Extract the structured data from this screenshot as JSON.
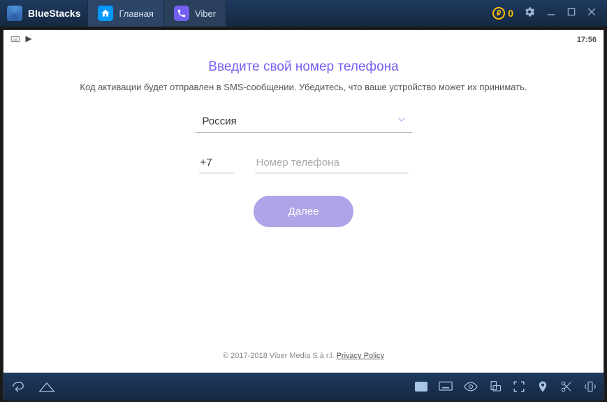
{
  "titlebar": {
    "brand": "BlueStacks",
    "tab_home": "Главная",
    "tab_viber": "Viber",
    "coins": "0"
  },
  "statusbar": {
    "time": "17:56"
  },
  "viber": {
    "title": "Введите свой номер телефона",
    "subtitle": "Код активации будет отправлен в SMS-сообщении. Убедитесь, что ваше устройство может их принимать.",
    "country": "Россия",
    "code": "+7",
    "phone_placeholder": "Номер телефона",
    "next": "Далее",
    "footer_copyright": "© 2017-2018 Viber Media S.à r.l. ",
    "footer_link": "Privacy Policy"
  }
}
